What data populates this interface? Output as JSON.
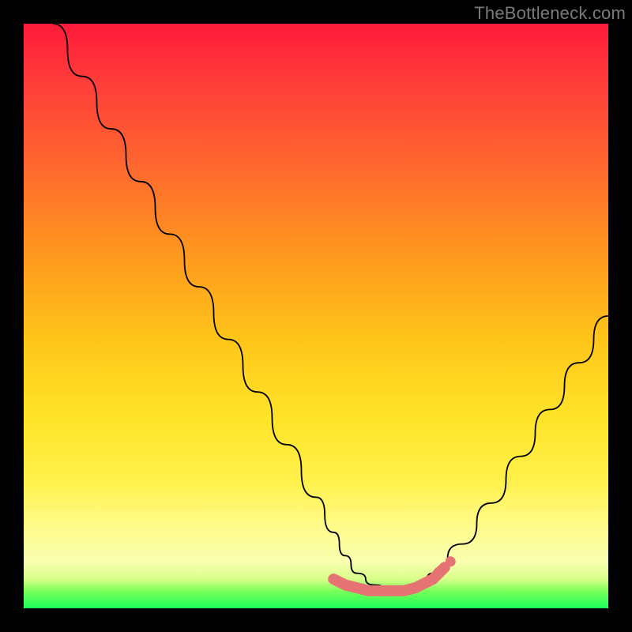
{
  "watermark": "TheBottleneck.com",
  "chart_data": {
    "type": "line",
    "title": "",
    "xlabel": "",
    "ylabel": "",
    "xlim": [
      0,
      100
    ],
    "ylim": [
      0,
      100
    ],
    "x": [
      5,
      10,
      15,
      20,
      25,
      30,
      35,
      40,
      45,
      50,
      53,
      55,
      57,
      60,
      63,
      65,
      68,
      70,
      75,
      80,
      85,
      90,
      95,
      100
    ],
    "values": [
      100,
      91,
      82,
      73,
      64,
      55,
      46,
      37,
      28,
      19,
      13,
      9,
      6,
      4,
      3,
      3,
      4,
      6,
      11,
      18,
      26,
      34,
      42,
      50
    ],
    "marker_points": {
      "x": [
        53,
        55,
        57,
        59,
        61,
        63,
        65,
        67,
        68,
        70,
        72
      ],
      "y": [
        5,
        4,
        3.5,
        3,
        3,
        3,
        3,
        3.5,
        4,
        5,
        7
      ]
    },
    "marker_color": "#e57373",
    "line_color": "#000000"
  }
}
